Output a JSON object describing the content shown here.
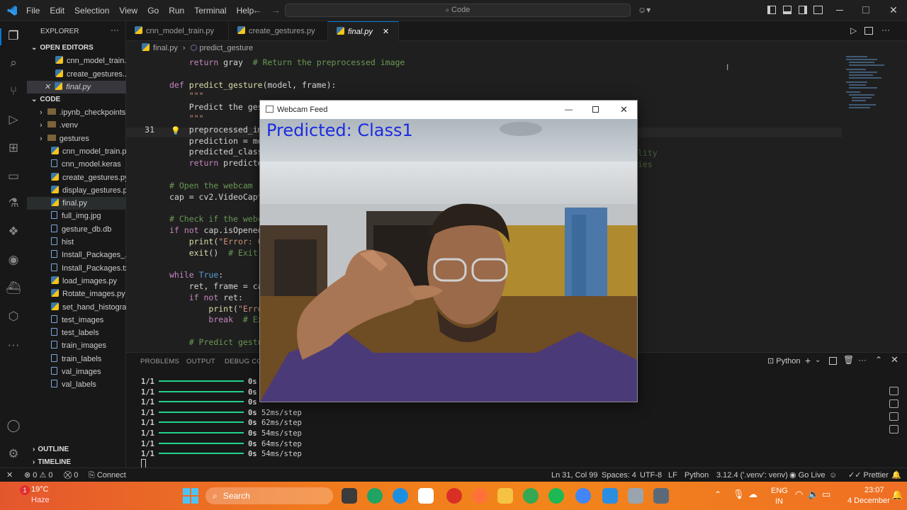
{
  "titlebar": {
    "menus": [
      "File",
      "Edit",
      "Selection",
      "View",
      "Go",
      "Run",
      "Terminal",
      "Help"
    ],
    "search": "Code"
  },
  "sidebar": {
    "title": "EXPLORER",
    "open_editors_header": "OPEN EDITORS",
    "open_editors": [
      "cnn_model_train...",
      "create_gestures...",
      "final.py"
    ],
    "folder_header": "CODE",
    "items": [
      {
        "label": ".ipynb_checkpoints",
        "kind": "folder"
      },
      {
        "label": ".venv",
        "kind": "folder"
      },
      {
        "label": "gestures",
        "kind": "folder"
      },
      {
        "label": "cnn_model_train.py",
        "kind": "py"
      },
      {
        "label": "cnn_model.keras",
        "kind": "file"
      },
      {
        "label": "create_gestures.py",
        "kind": "py"
      },
      {
        "label": "display_gestures.py",
        "kind": "py"
      },
      {
        "label": "final.py",
        "kind": "py"
      },
      {
        "label": "full_img.jpg",
        "kind": "file"
      },
      {
        "label": "gesture_db.db",
        "kind": "file"
      },
      {
        "label": "hist",
        "kind": "file"
      },
      {
        "label": "Install_Packages_...",
        "kind": "file"
      },
      {
        "label": "Install_Packages.txt",
        "kind": "file"
      },
      {
        "label": "load_images.py",
        "kind": "py"
      },
      {
        "label": "Rotate_images.py",
        "kind": "py"
      },
      {
        "label": "set_hand_histogra...",
        "kind": "py"
      },
      {
        "label": "test_images",
        "kind": "file"
      },
      {
        "label": "test_labels",
        "kind": "file"
      },
      {
        "label": "train_images",
        "kind": "file"
      },
      {
        "label": "train_labels",
        "kind": "file"
      },
      {
        "label": "val_images",
        "kind": "file"
      },
      {
        "label": "val_labels",
        "kind": "file"
      }
    ],
    "outline": "OUTLINE",
    "timeline": "TIMELINE"
  },
  "tabs": [
    "cnn_model_train.py",
    "create_gestures.py",
    "final.py"
  ],
  "breadcrumb": [
    "final.py",
    "predict_gesture"
  ],
  "code": {
    "lines": [
      {
        "n": "",
        "t": "    return gray  # Return the preprocessed image"
      },
      {
        "n": "",
        "t": ""
      },
      {
        "n": "",
        "t": "def predict_gesture(model, frame):"
      },
      {
        "n": "",
        "t": "    \"\"\""
      },
      {
        "n": "",
        "t": "    Predict the gest"
      },
      {
        "n": "",
        "t": "    \"\"\""
      },
      {
        "n": "31",
        "t": "    preprocessed_ima"
      },
      {
        "n": "",
        "t": "    prediction = mod"
      },
      {
        "n": "",
        "t": "    predicted_class_"
      },
      {
        "n": "",
        "t": "    return predicted"
      },
      {
        "n": "",
        "t": ""
      },
      {
        "n": "",
        "t": "# Open the webcam ("
      },
      {
        "n": "",
        "t": "cap = cv2.VideoCaptu"
      },
      {
        "n": "",
        "t": ""
      },
      {
        "n": "",
        "t": "# Check if the webca"
      },
      {
        "n": "",
        "t": "if not cap.isOpened("
      },
      {
        "n": "",
        "t": "    print(\"Error: Co"
      },
      {
        "n": "",
        "t": "    exit()  # Exit"
      },
      {
        "n": "",
        "t": ""
      },
      {
        "n": "",
        "t": "while True:"
      },
      {
        "n": "",
        "t": "    ret, frame = cap"
      },
      {
        "n": "",
        "t": "    if not ret:"
      },
      {
        "n": "",
        "t": "        print(\"Error"
      },
      {
        "n": "",
        "t": "        break  # Ex"
      },
      {
        "n": "",
        "t": ""
      },
      {
        "n": "",
        "t": "    # Predict gestu"
      }
    ],
    "overflow_right": [
      "lity",
      "ies"
    ]
  },
  "panel": {
    "tabs": [
      "PROBLEMS",
      "OUTPUT",
      "DEBUG CON"
    ],
    "terminal_label": "Python",
    "lines": [
      {
        "a": "1/1",
        "b": "0s",
        "c": ""
      },
      {
        "a": "1/1",
        "b": "0s",
        "c": ""
      },
      {
        "a": "1/1",
        "b": "0s",
        "c": ""
      },
      {
        "a": "1/1",
        "b": "0s",
        "c": "52ms/step"
      },
      {
        "a": "1/1",
        "b": "0s",
        "c": "62ms/step"
      },
      {
        "a": "1/1",
        "b": "0s",
        "c": "54ms/step"
      },
      {
        "a": "1/1",
        "b": "0s",
        "c": "64ms/step"
      },
      {
        "a": "1/1",
        "b": "0s",
        "c": "54ms/step"
      }
    ]
  },
  "webcam": {
    "title": "Webcam Feed",
    "prediction": "Predicted: Class1"
  },
  "status": {
    "errors": "0",
    "warnings": "0",
    "ports": "0",
    "connect": "Connect",
    "position": "Ln 31, Col 99",
    "spaces": "Spaces: 4",
    "encoding": "UTF-8",
    "eol": "LF",
    "language": "Python",
    "interpreter": "3.12.4 ('.venv': venv)",
    "golive": "Go Live",
    "prettier": "Prettier"
  },
  "taskbar": {
    "weather_temp": "19°C",
    "weather_desc": "Haze",
    "search": "Search",
    "lang1": "ENG",
    "lang2": "IN",
    "time": "23:07",
    "date": "4 December",
    "badge": "1"
  }
}
